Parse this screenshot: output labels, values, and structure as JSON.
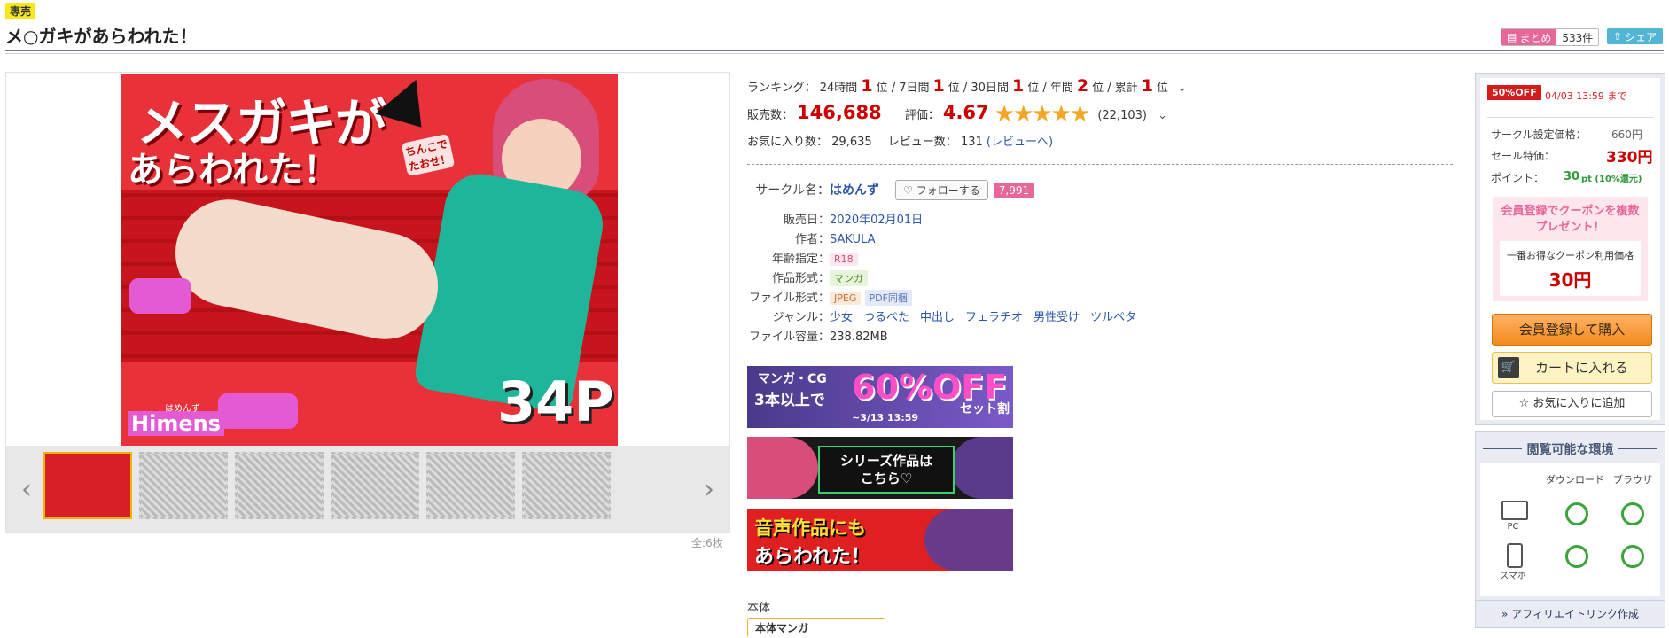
{
  "header": {
    "badge": "専売",
    "title": "メ○ガキがあらわれた！",
    "matome_label": "まとめ",
    "matome_count": "533件",
    "share_label": "シェア"
  },
  "gallery": {
    "main_image_text": {
      "title_line1": "メスガキが",
      "title_line2": "あらわれた！",
      "callout": "ちんこでたおせ！",
      "pages": "34P",
      "logo": "Himens",
      "logo_sub": "はめんず"
    },
    "thumb_count": 6,
    "total_label": "全:6枚"
  },
  "ranking": {
    "label": "ランキング：",
    "items": [
      {
        "period": "24時間",
        "rank": "1",
        "unit": "位"
      },
      {
        "period": "7日間",
        "rank": "1",
        "unit": "位"
      },
      {
        "period": "30日間",
        "rank": "1",
        "unit": "位"
      },
      {
        "period": "年間",
        "rank": "2",
        "unit": "位"
      },
      {
        "period": "累計",
        "rank": "1",
        "unit": "位"
      }
    ]
  },
  "stats": {
    "sales_label": "販売数：",
    "sales_value": "146,688",
    "rating_label": "評価：",
    "rating_value": "4.67",
    "rating_count": "(22,103)",
    "fav_label": "お気に入り数：",
    "fav_value": "29,635",
    "review_label": "レビュー数：",
    "review_value": "131",
    "review_link": "(レビューへ)"
  },
  "details": {
    "circle_label": "サークル名：",
    "circle_name": "はめんず",
    "follow_label": "フォローする",
    "follow_count": "7,991",
    "release_label": "販売日：",
    "release_value": "2020年02月01日",
    "author_label": "作者：",
    "author_value": "SAKULA",
    "age_label": "年齢指定：",
    "age_value": "R18",
    "type_label": "作品形式：",
    "type_value": "マンガ",
    "format_label": "ファイル形式：",
    "format_value1": "JPEG",
    "format_value2": "PDF同梱",
    "genre_label": "ジャンル：",
    "genres": [
      "少女",
      "つるぺた",
      "中出し",
      "フェラチオ",
      "男性受け",
      "ツルペタ"
    ],
    "size_label": "ファイル容量：",
    "size_value": "238.82MB"
  },
  "banners": {
    "b1_line1": "マンガ・CG",
    "b1_line2": "3本以上で",
    "b1_big": "60%OFF",
    "b1_tail": "セット割",
    "b1_date": "~3/13 13:59",
    "b2_line1": "シリーズ作品は",
    "b2_line2": "こちら♡",
    "b3_line1": "音声作品にも",
    "b3_line2": "あらわれた！"
  },
  "honpen": {
    "label": "本体",
    "tab": "本体マンガ"
  },
  "sidebar": {
    "off_badge": "50%OFF",
    "off_until": "04/03 13:59 まで",
    "circle_price_label": "サークル設定価格：",
    "circle_price": "660円",
    "sale_label": "セール特価：",
    "sale_price": "330円",
    "point_label": "ポイント：",
    "point_value": "30",
    "point_unit": "pt (10%還元)",
    "coupon_title1": "会員登録でクーポンを複数",
    "coupon_title2": "プレゼント！",
    "coupon_box_label": "一番お得なクーポン利用価格",
    "coupon_price": "30円",
    "buy_label": "会員登録して購入",
    "cart_label": "カートに入れる",
    "fav_label": "お気に入りに追加"
  },
  "environment": {
    "title": "閲覧可能な環境",
    "col_download": "ダウンロード",
    "col_browser": "ブラウザ",
    "row_pc": "PC",
    "row_phone": "スマホ"
  },
  "affiliate": {
    "label": "» アフィリエイトリンク作成"
  },
  "colors": {
    "accent_red": "#cc0000",
    "star": "#f5a623",
    "pink": "#e8679a",
    "link": "#2a56a8"
  }
}
